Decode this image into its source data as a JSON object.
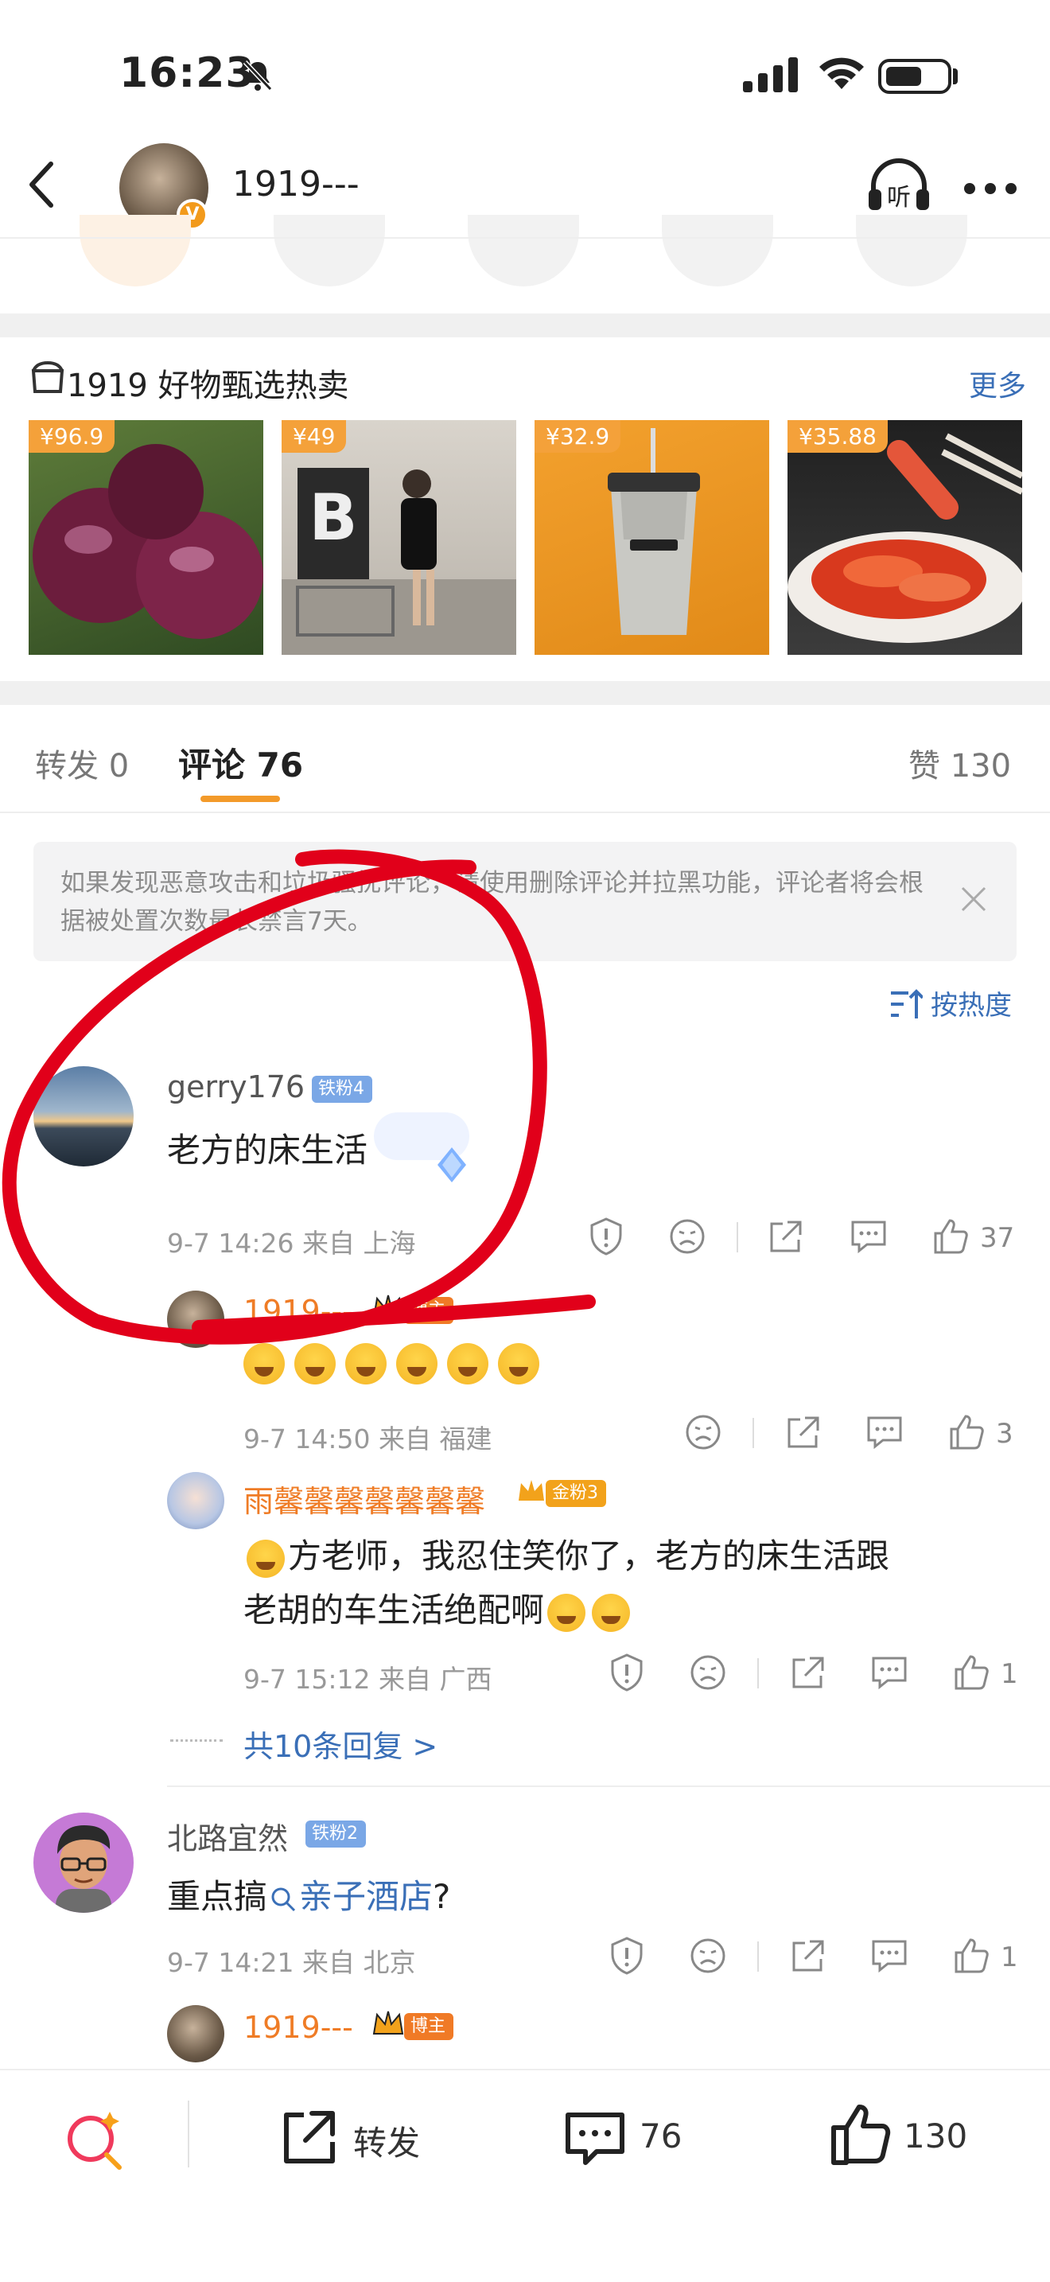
{
  "status_bar": {
    "time": "16:23"
  },
  "header": {
    "username": "1919---",
    "owner_badge": "V"
  },
  "shop": {
    "title": "1919 好物甄选热卖",
    "more": "更多",
    "products": [
      {
        "price": "¥96.9"
      },
      {
        "price": "¥49"
      },
      {
        "price": "¥32.9"
      },
      {
        "price": "¥35.88"
      }
    ]
  },
  "tabs": {
    "repost": "转发 0",
    "comment": "评论 76",
    "like": "赞 130"
  },
  "notice": {
    "text": "如果发现恶意攻击和垃圾骚扰评论，请使用删除评论并拉黑功能，评论者将会根据被处置次数最长禁言7天。"
  },
  "sort": {
    "label": "按热度"
  },
  "comments": [
    {
      "username": "gerry176",
      "badge": "铁粉4",
      "text": "老方的床生活",
      "meta": "9-7 14:26 来自 上海",
      "likes": "37",
      "replies": [
        {
          "username": "1919---",
          "badge": "博主",
          "emoji_count": 6,
          "meta": "9-7 14:50 来自 福建",
          "likes": "3"
        },
        {
          "username": "雨馨馨馨馨馨馨馨",
          "badge": "金粉3",
          "text_line1": "方老师，我忍住笑你了，老方的床生活跟",
          "text_line2": "老胡的车生活绝配啊",
          "meta": "9-7 15:12 来自 广西",
          "likes": "1"
        }
      ],
      "more_replies": "共10条回复 >"
    },
    {
      "username": "北路宜然",
      "badge": "铁粉2",
      "text_prefix": "重点搞",
      "text_link": "亲子酒店",
      "text_suffix": "?",
      "meta": "9-7 14:21 来自 北京",
      "likes": "1",
      "replies": [
        {
          "username": "1919---",
          "badge": "博主"
        }
      ]
    }
  ],
  "bottom_bar": {
    "repost": "转发",
    "comment_count": "76",
    "like_count": "130"
  },
  "colors": {
    "accent": "#f39a2a",
    "link": "#3a6fb7",
    "owner": "#ef7c26",
    "annotation": "#e1001a"
  }
}
